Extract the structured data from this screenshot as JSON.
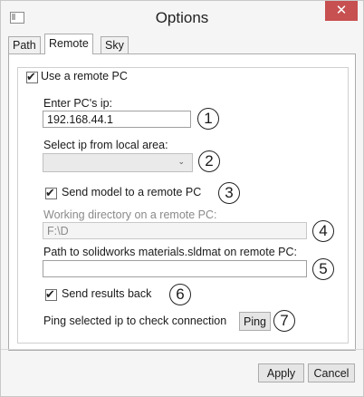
{
  "window": {
    "title": "Options",
    "close_glyph": "✕"
  },
  "tabs": [
    {
      "label": "Path"
    },
    {
      "label": "Remote"
    },
    {
      "label": "Sky"
    }
  ],
  "remote": {
    "use_remote_label": "Use a remote PC",
    "use_remote_checked": true,
    "ip_label": "Enter PC's ip:",
    "ip_value": "192.168.44.1",
    "select_label": "Select ip from local area:",
    "select_value": "",
    "send_model_label": "Send model to a remote PC",
    "send_model_checked": true,
    "workdir_label": "Working directory on a remote PC:",
    "workdir_value": "F:\\D",
    "materials_label": "Path to solidworks materials.sldmat on remote PC:",
    "materials_value": "",
    "send_results_label": "Send results back",
    "send_results_checked": true,
    "ping_label": "Ping selected ip to check connection",
    "ping_button": "Ping"
  },
  "annotations": [
    "1",
    "2",
    "3",
    "4",
    "5",
    "6",
    "7"
  ],
  "footer": {
    "apply": "Apply",
    "cancel": "Cancel"
  },
  "icons": {
    "app": "window-icon",
    "close": "close-icon",
    "dropdown": "chevron-down-icon"
  }
}
